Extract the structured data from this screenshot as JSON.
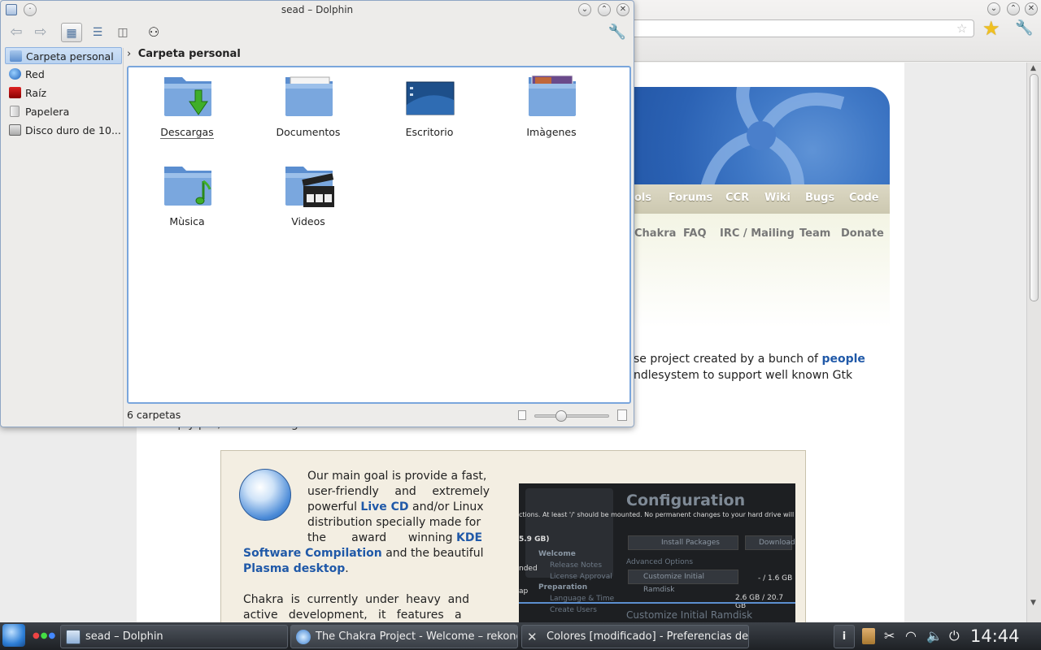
{
  "dolphin": {
    "title": "sead – Dolphin",
    "places": [
      {
        "label": "Carpeta personal",
        "icon": "home-folder-icon"
      },
      {
        "label": "Red",
        "icon": "network-globe-icon"
      },
      {
        "label": "Raíz",
        "icon": "root-folder-icon"
      },
      {
        "label": "Papelera",
        "icon": "trash-icon"
      },
      {
        "label": "Disco duro de 10...",
        "icon": "hard-disk-icon"
      }
    ],
    "breadcrumb": "Carpeta personal",
    "folders": [
      {
        "label": "Descargas",
        "icon": "downloads-folder-icon"
      },
      {
        "label": "Documentos",
        "icon": "documents-folder-icon"
      },
      {
        "label": "Escritorio",
        "icon": "desktop-folder-icon"
      },
      {
        "label": "Imàgenes",
        "icon": "pictures-folder-icon"
      },
      {
        "label": "Mùsica",
        "icon": "music-folder-icon"
      },
      {
        "label": "Videos",
        "icon": "videos-folder-icon"
      }
    ],
    "status": "6 carpetas",
    "zoom_fraction": 0.25
  },
  "browser": {
    "nav_top": [
      "ols",
      "Forums",
      "CCR",
      "Wiki",
      "Bugs",
      "Code"
    ],
    "nav_bottom": [
      "Chakra",
      "FAQ",
      "IRC / Mailing",
      "Team",
      "Donate"
    ],
    "intro_line1_a": "se project created by a bunch of ",
    "intro_line1_b": "people",
    "intro_line2": "ndlesystem  to  support  well  known  Gtk",
    "intro_line3": "Simply put, we are doing a loose start",
    "feature": {
      "p1_a": "Our main goal is provide a fast,",
      "p1_b": "user-friendly  and  extremely",
      "p1_c1": "powerful ",
      "p1_c2": "Live CD",
      "p1_c3": " and/or Linux",
      "p1_d": "distribution specially made for",
      "p1_e1": "the       award      winning ",
      "p1_e2": "KDE",
      "p1_f1": "Software Compilation",
      "p1_f2": " and the beautiful",
      "p1_g1": "Plasma desktop",
      "p1_g2": ".",
      "p2_a": "Chakra  is  currently  under  heavy  and",
      "p2_b": "active   development,   it   features   a"
    },
    "screenshot": {
      "title": "Configuration",
      "line": "ctions. At least '/' should be mounted. No permanent changes to your hard drive will be",
      "size": "5.9 GB)",
      "welcome": "Welcome",
      "release": "Release Notes",
      "license": "License Approval",
      "prep": "Preparation",
      "lang": "Language & Time",
      "users": "Create Users",
      "install": "Install Packages",
      "download": "Download",
      "adv": "Advanced Options",
      "ramdisk": "Customize Initial Ramdisk",
      "ramdisk_size": "- / 1.6 GB",
      "disk": "2.6 GB / 20.7 GB",
      "ended": "nded",
      "ap": "ap",
      "custom": "Customize Initial Ramdisk"
    }
  },
  "taskbar": {
    "tasks": [
      {
        "label": "sead – Dolphin",
        "icon": "dolphin-app-icon"
      },
      {
        "label": "The Chakra Project - Welcome – rekonq",
        "icon": "rekonq-app-icon"
      },
      {
        "label": "Colores [modificado] - Preferencias del s",
        "icon": "system-settings-icon"
      }
    ],
    "clock": "14:44"
  }
}
